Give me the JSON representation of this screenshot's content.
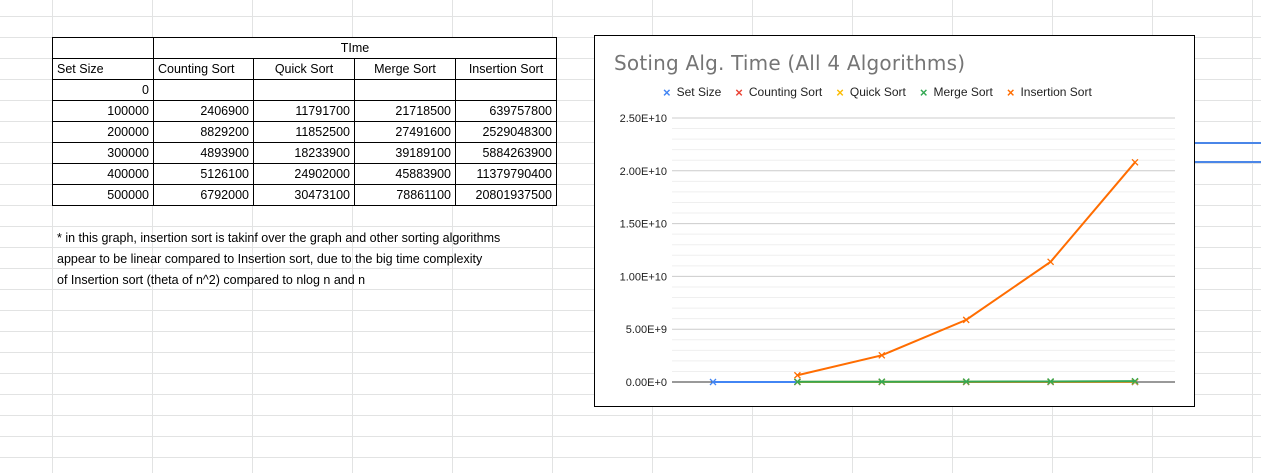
{
  "table": {
    "header_group": "TIme",
    "columns": [
      "Set Size",
      "Counting Sort",
      "Quick Sort",
      "Merge Sort",
      "Insertion Sort"
    ],
    "rows": [
      [
        "0",
        "",
        "",
        "",
        ""
      ],
      [
        "100000",
        "2406900",
        "11791700",
        "21718500",
        "639757800"
      ],
      [
        "200000",
        "8829200",
        "11852500",
        "27491600",
        "2529048300"
      ],
      [
        "300000",
        "4893900",
        "18233900",
        "39189100",
        "5884263900"
      ],
      [
        "400000",
        "5126100",
        "24902000",
        "45883900",
        "11379790400"
      ],
      [
        "500000",
        "6792000",
        "30473100",
        "78861100",
        "20801937500"
      ]
    ]
  },
  "note": {
    "line1": "* in this graph, insertion sort is takinf over the graph and other sorting algorithms",
    "line2": "appear to be linear compared to Insertion sort, due to the big time complexity",
    "line3": "of Insertion sort (theta of n^2) compared to nlog n and n"
  },
  "chart_data": {
    "type": "line",
    "title": "Soting Alg. Time (All 4 Algorithms)",
    "legend_position": "top",
    "grid": true,
    "ylim": [
      0,
      25000000000
    ],
    "y_ticks": [
      0,
      5000000000,
      10000000000,
      15000000000,
      20000000000,
      25000000000
    ],
    "y_tick_labels": [
      "0.00E+0",
      "5.00E+9",
      "1.00E+10",
      "1.50E+10",
      "2.00E+10",
      "2.50E+10"
    ],
    "x": [
      1,
      2,
      3,
      4,
      5,
      6
    ],
    "series": [
      {
        "name": "Set Size",
        "color": "#4285f4",
        "values": [
          0,
          100000,
          200000,
          300000,
          400000,
          500000
        ]
      },
      {
        "name": "Counting Sort",
        "color": "#ea4335",
        "values": [
          null,
          2406900,
          8829200,
          4893900,
          5126100,
          6792000
        ]
      },
      {
        "name": "Quick Sort",
        "color": "#fbbc04",
        "values": [
          null,
          11791700,
          11852500,
          18233900,
          24902000,
          30473100
        ]
      },
      {
        "name": "Merge Sort",
        "color": "#34a853",
        "values": [
          null,
          21718500,
          27491600,
          39189100,
          45883900,
          78861100
        ]
      },
      {
        "name": "Insertion Sort",
        "color": "#ff6d01",
        "values": [
          null,
          639757800,
          2529048300,
          5884263900,
          11379790400,
          20801937500
        ]
      }
    ]
  },
  "sheet": {
    "accent_line_color": "#4a86e8"
  }
}
